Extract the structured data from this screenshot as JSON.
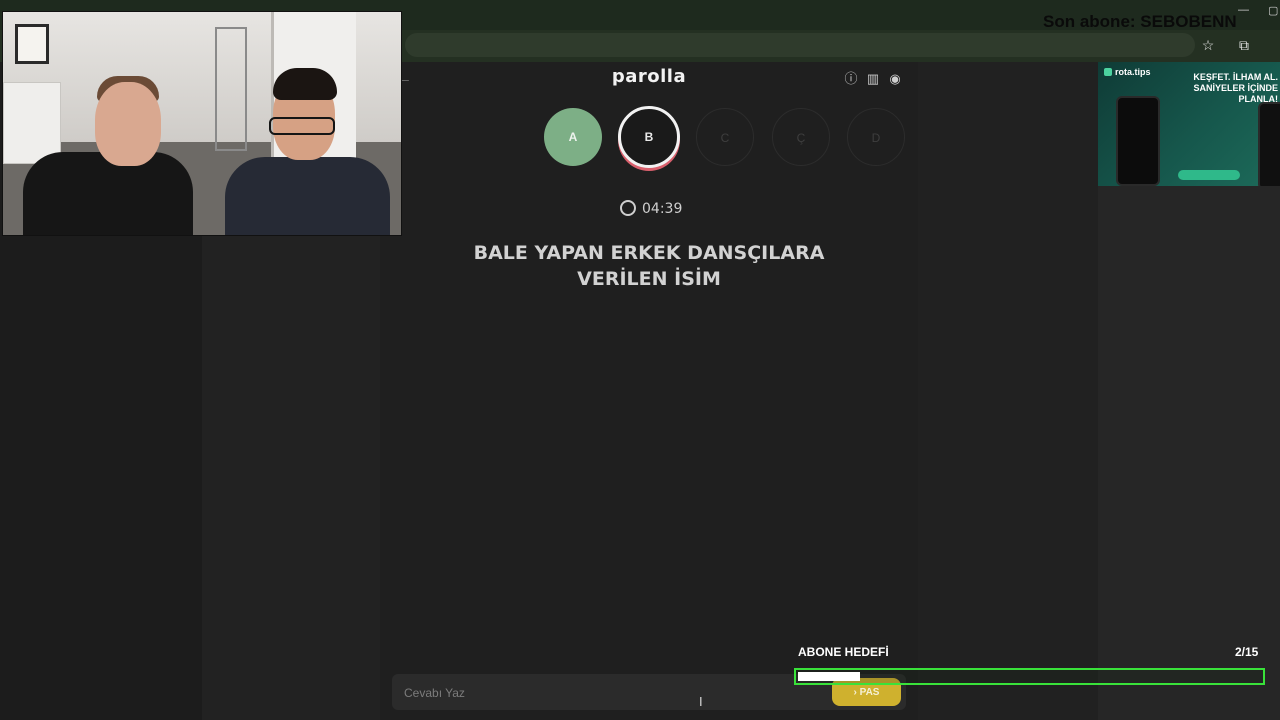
{
  "overlay": {
    "last_subscriber": "Son abone: SEBOBENN",
    "goal_label": "ABONE HEDEFİ",
    "goal_count": "2/15",
    "goal_current": 2,
    "goal_target": 15
  },
  "browser": {
    "icons": [
      "star-icon",
      "extensions-icon",
      "profile-icon"
    ]
  },
  "game": {
    "brand": "parolla",
    "header_icons": [
      "info-icon",
      "stats-icon",
      "account-icon"
    ],
    "letters": [
      {
        "label": "A",
        "state": "done"
      },
      {
        "label": "B",
        "state": "active"
      },
      {
        "label": "C",
        "state": "pending"
      },
      {
        "label": "Ç",
        "state": "pending"
      },
      {
        "label": "D",
        "state": "pending"
      }
    ],
    "timer": "04:39",
    "question_line1": "BALE YAPAN ERKEK DANSÇILARA",
    "question_line2": "VERİLEN İSİM",
    "answer_placeholder": "Cevabı Yaz",
    "pass_label": "PAS"
  },
  "ad": {
    "brand": "rota.tips",
    "title_line1": "KEŞFET. İLHAM AL.",
    "title_line2": "SANİYELER İÇİNDE PLANLA!"
  },
  "colors": {
    "done": "#7daf86",
    "active_ring": "#d9606d",
    "pass_button": "#cfb12e",
    "goal_border": "#39e23a"
  }
}
